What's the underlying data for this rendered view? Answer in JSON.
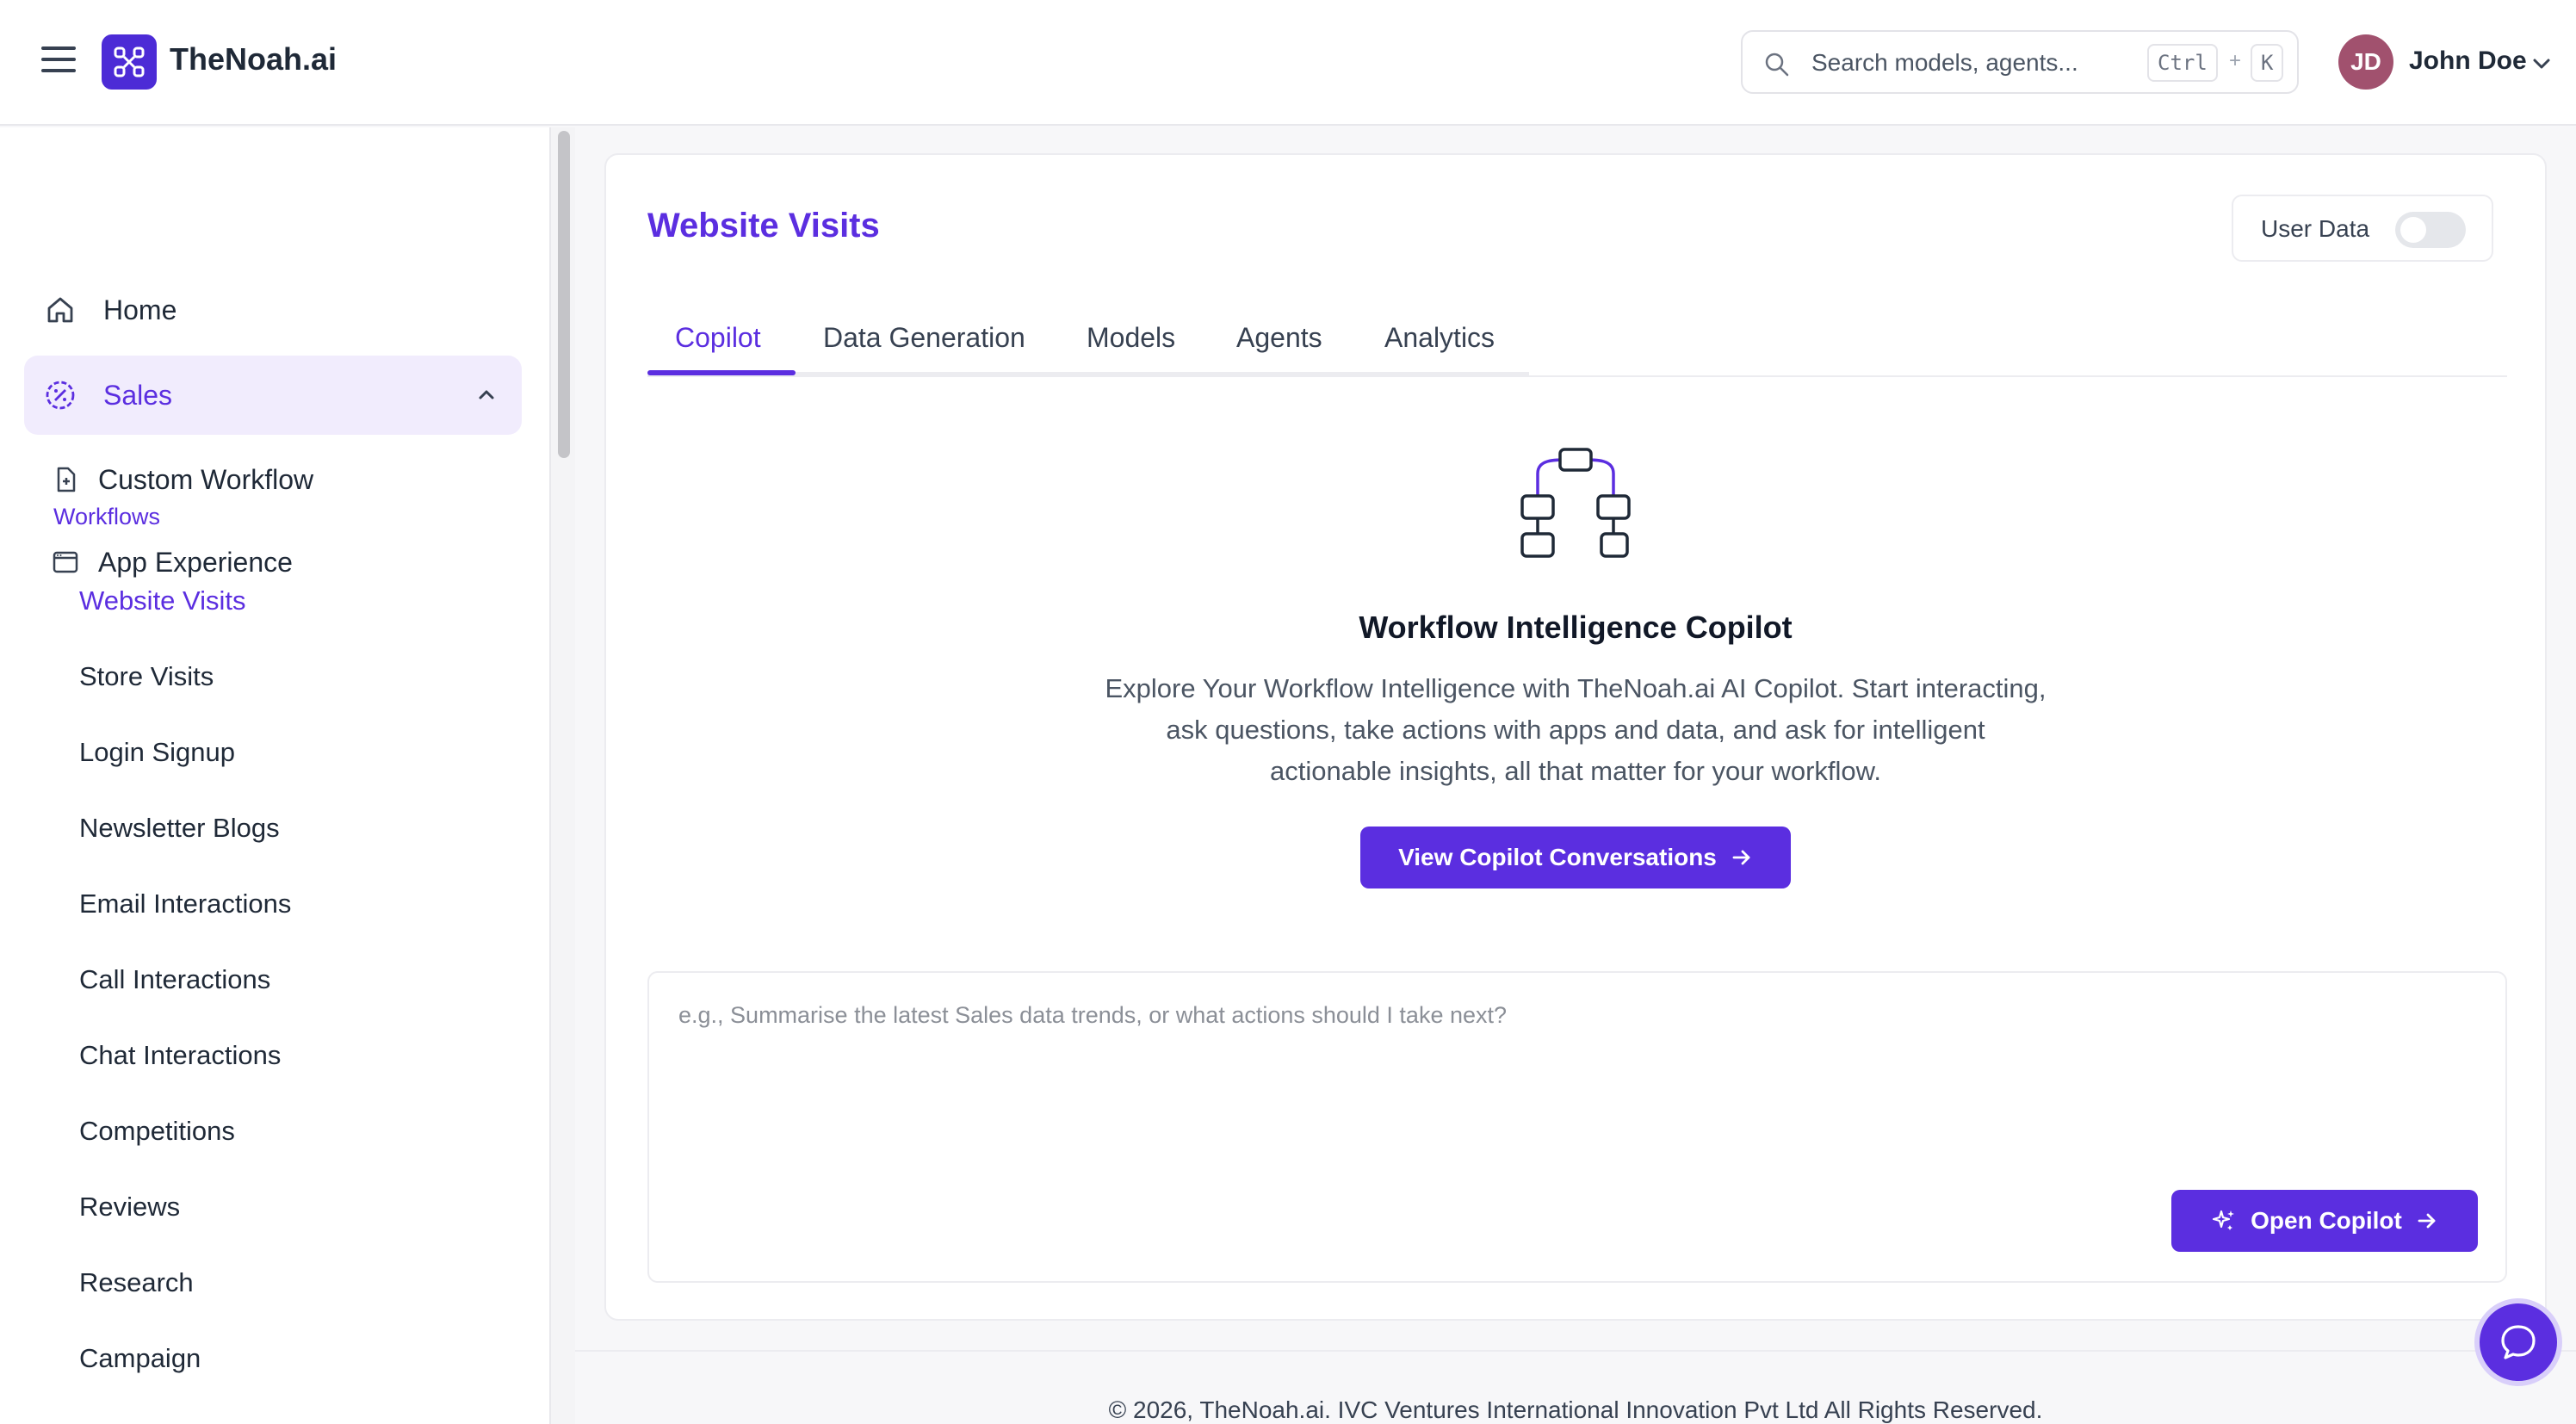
{
  "header": {
    "brand": "TheNoah.ai",
    "search": {
      "placeholder": "Search models, agents...",
      "shortcut_ctrl": "Ctrl",
      "shortcut_plus": "+",
      "shortcut_key": "K"
    },
    "user": {
      "initials": "JD",
      "name": "John Doe"
    }
  },
  "sidebar": {
    "items": [
      {
        "label": "Home",
        "icon": "home-icon"
      },
      {
        "label": "Sales",
        "icon": "sales-icon",
        "expanded": true
      },
      {
        "label": "Custom Workflow",
        "icon": "file-plus-icon"
      },
      {
        "label": "App Experience",
        "icon": "browser-icon"
      }
    ],
    "section_label": "Workflows",
    "workflows": [
      "Website Visits",
      "Store Visits",
      "Login Signup",
      "Newsletter Blogs",
      "Email Interactions",
      "Call Interactions",
      "Chat Interactions",
      "Competitions",
      "Reviews",
      "Research",
      "Campaign"
    ],
    "active_workflow": "Website Visits"
  },
  "main": {
    "title": "Website Visits",
    "toggle": {
      "label": "User Data",
      "on": false
    },
    "tabs": [
      "Copilot",
      "Data Generation",
      "Models",
      "Agents",
      "Analytics"
    ],
    "active_tab": "Copilot",
    "hero": {
      "icon": "workflow-tree-icon",
      "title": "Workflow Intelligence Copilot",
      "description": "Explore Your Workflow Intelligence with TheNoah.ai AI Copilot. Start interacting, ask questions, take actions with apps and data, and ask for intelligent actionable insights, all that matter for your workflow.",
      "button": "View Copilot Conversations"
    },
    "prompt": {
      "placeholder": "e.g., Summarise the latest Sales data trends, or what actions should I take next?",
      "button": "Open Copilot"
    }
  },
  "footer": {
    "text": "© 2026, TheNoah.ai. IVC Ventures International Innovation Pvt Ltd All Rights Reserved."
  },
  "colors": {
    "accent": "#5b2ee0",
    "logo_bg": "#4c2bd6",
    "avatar_bg": "#a1516e",
    "active_bg": "#f1ecfd"
  }
}
